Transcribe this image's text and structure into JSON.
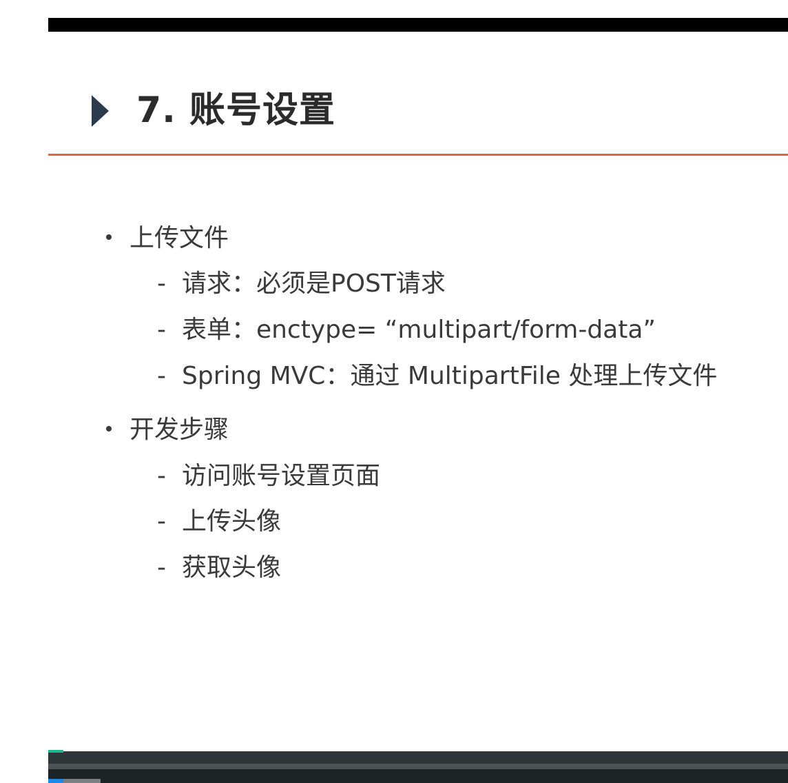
{
  "slide": {
    "title": "7. 账号设置",
    "sections": [
      {
        "heading": "上传文件",
        "items": [
          "请求：必须是POST请求",
          "表单：enctype= “multipart/form-data”",
          "Spring MVC：通过 MultipartFile 处理上传文件"
        ]
      },
      {
        "heading": "开发步骤",
        "items": [
          "访问账号设置页面",
          "上传头像",
          "获取头像"
        ]
      }
    ]
  },
  "icons": {
    "title_marker": "triangle-right-icon",
    "bullet": "bullet-dot-icon",
    "sub_bullet": "dash"
  },
  "colors": {
    "title_rule": "#e8643a",
    "title_arrow": "#2b3a4d",
    "player_bar": "#2e3538",
    "player_accent": "#1fb58f",
    "progress": "#1e88e5"
  }
}
